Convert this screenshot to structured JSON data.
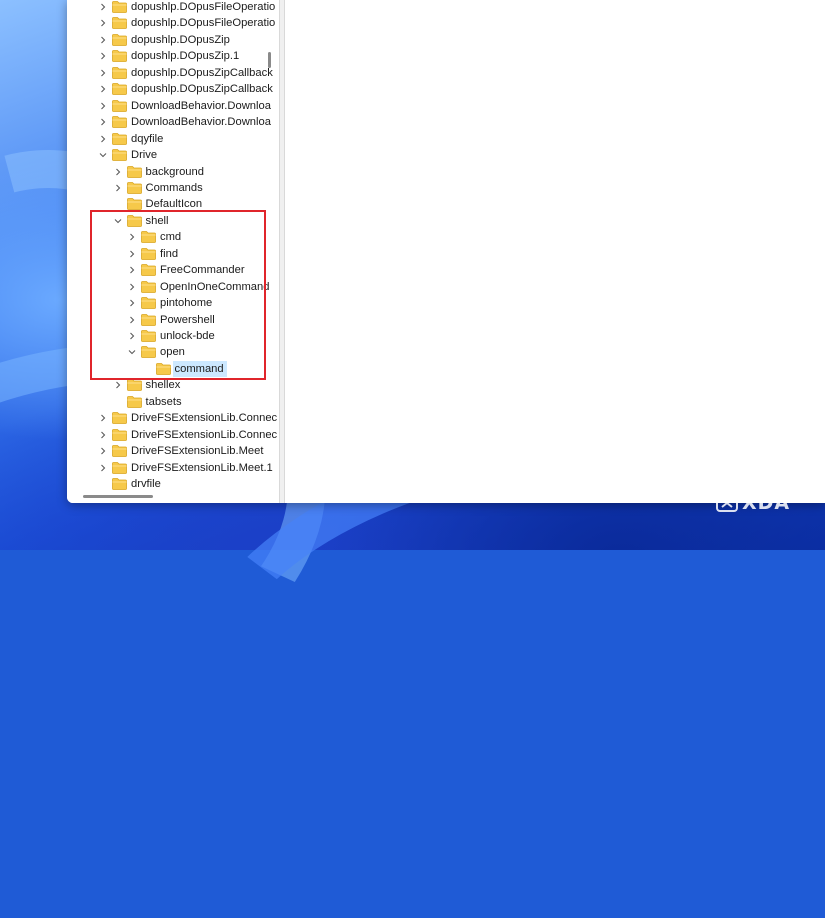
{
  "tree": {
    "items": [
      {
        "label": "dopushlp.DOpusFileOperatio",
        "level": 0,
        "expander": "collapsed"
      },
      {
        "label": "dopushlp.DOpusFileOperatio",
        "level": 0,
        "expander": "collapsed"
      },
      {
        "label": "dopushlp.DOpusZip",
        "level": 0,
        "expander": "collapsed"
      },
      {
        "label": "dopushlp.DOpusZip.1",
        "level": 0,
        "expander": "collapsed"
      },
      {
        "label": "dopushlp.DOpusZipCallback",
        "level": 0,
        "expander": "collapsed"
      },
      {
        "label": "dopushlp.DOpusZipCallback",
        "level": 0,
        "expander": "collapsed"
      },
      {
        "label": "DownloadBehavior.Downloa",
        "level": 0,
        "expander": "collapsed"
      },
      {
        "label": "DownloadBehavior.Downloa",
        "level": 0,
        "expander": "collapsed"
      },
      {
        "label": "dqyfile",
        "level": 0,
        "expander": "collapsed"
      },
      {
        "label": "Drive",
        "level": 0,
        "expander": "expanded"
      },
      {
        "label": "background",
        "level": 1,
        "expander": "collapsed"
      },
      {
        "label": "Commands",
        "level": 1,
        "expander": "collapsed"
      },
      {
        "label": "DefaultIcon",
        "level": 1,
        "expander": "none"
      },
      {
        "label": "shell",
        "level": 1,
        "expander": "expanded"
      },
      {
        "label": "cmd",
        "level": 2,
        "expander": "collapsed"
      },
      {
        "label": "find",
        "level": 2,
        "expander": "collapsed"
      },
      {
        "label": "FreeCommander",
        "level": 2,
        "expander": "collapsed"
      },
      {
        "label": "OpenInOneCommand",
        "level": 2,
        "expander": "collapsed"
      },
      {
        "label": "pintohome",
        "level": 2,
        "expander": "collapsed"
      },
      {
        "label": "Powershell",
        "level": 2,
        "expander": "collapsed"
      },
      {
        "label": "unlock-bde",
        "level": 2,
        "expander": "collapsed"
      },
      {
        "label": "open",
        "level": 2,
        "expander": "expanded"
      },
      {
        "label": "command",
        "level": 3,
        "expander": "none",
        "selected": true
      },
      {
        "label": "shellex",
        "level": 1,
        "expander": "collapsed"
      },
      {
        "label": "tabsets",
        "level": 1,
        "expander": "none"
      },
      {
        "label": "DriveFSExtensionLib.Connec",
        "level": 0,
        "expander": "collapsed"
      },
      {
        "label": "DriveFSExtensionLib.Connec",
        "level": 0,
        "expander": "collapsed"
      },
      {
        "label": "DriveFSExtensionLib.Meet",
        "level": 0,
        "expander": "collapsed"
      },
      {
        "label": "DriveFSExtensionLib.Meet.1",
        "level": 0,
        "expander": "collapsed"
      },
      {
        "label": "drvfile",
        "level": 0,
        "expander": "none"
      }
    ]
  },
  "watermark": {
    "text": "XDA"
  },
  "colors": {
    "selection": "#cce8ff",
    "highlight_box": "#e0252b",
    "folder": "#f6c94a"
  }
}
